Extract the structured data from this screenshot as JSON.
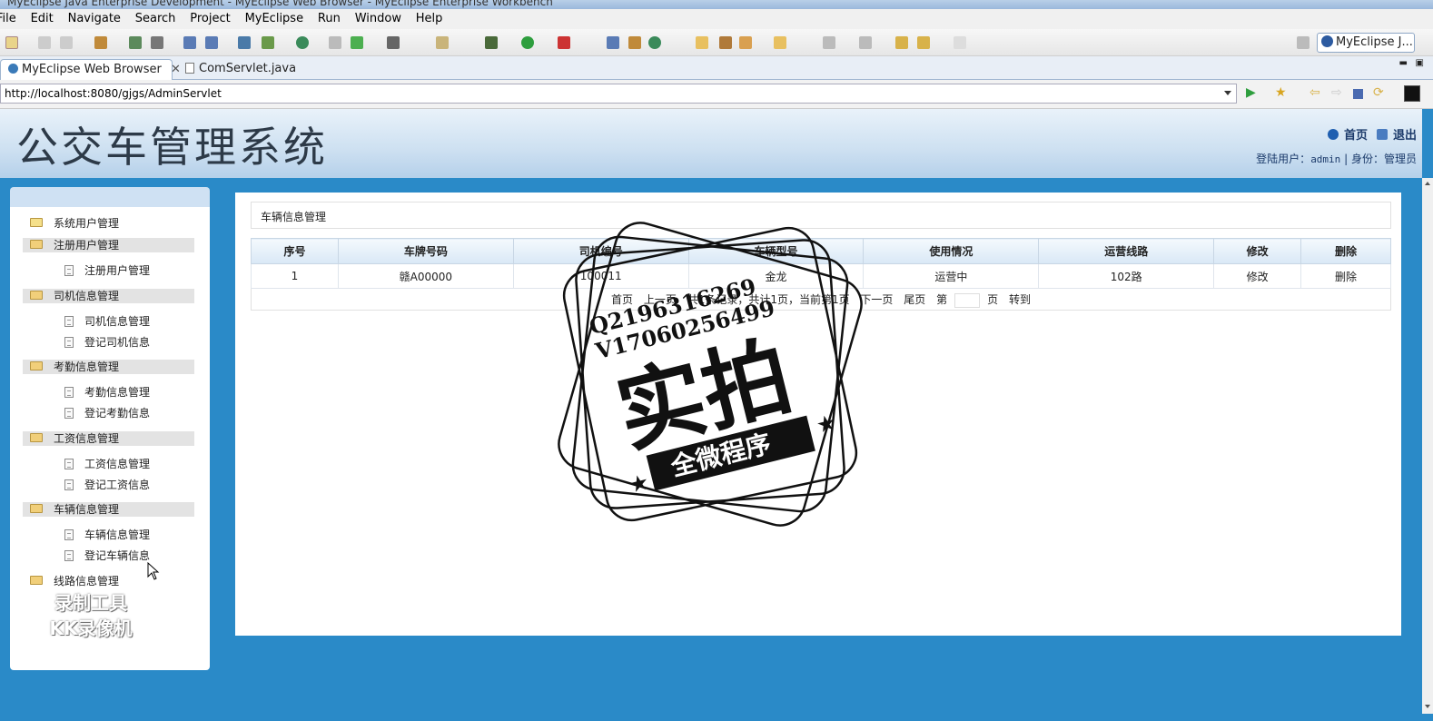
{
  "window": {
    "title": "MyEclipse Java Enterprise Development - MyEclipse Web Browser - MyEclipse Enterprise Workbench"
  },
  "menu": [
    "File",
    "Edit",
    "Navigate",
    "Search",
    "Project",
    "MyEclipse",
    "Run",
    "Window",
    "Help"
  ],
  "perspective": "MyEclipse J...",
  "tabs": [
    {
      "label": "MyEclipse Web Browser",
      "active": true
    },
    {
      "label": "ComServlet.java",
      "active": false
    }
  ],
  "address": {
    "url": "http://localhost:8080/gjgs/AdminServlet"
  },
  "header": {
    "title": "公交车管理系统",
    "home_link": "首页",
    "logout_link": "退出",
    "user_label": "登陆用户：",
    "user_name": "admin",
    "role_label": "| 身份：管理员"
  },
  "sidebar": {
    "groups": [
      {
        "label": "系统用户管理",
        "items": []
      },
      {
        "label": "注册用户管理",
        "items": [
          "注册用户管理"
        ]
      },
      {
        "label": "司机信息管理",
        "items": [
          "司机信息管理",
          "登记司机信息"
        ]
      },
      {
        "label": "考勤信息管理",
        "items": [
          "考勤信息管理",
          "登记考勤信息"
        ]
      },
      {
        "label": "工资信息管理",
        "items": [
          "工资信息管理",
          "登记工资信息"
        ]
      },
      {
        "label": "车辆信息管理",
        "items": [
          "车辆信息管理",
          "登记车辆信息"
        ]
      },
      {
        "label": "线路信息管理",
        "items": []
      }
    ]
  },
  "main": {
    "breadcrumb": "车辆信息管理",
    "table": {
      "headers": [
        "序号",
        "车牌号码",
        "司机编号",
        "车辆型号",
        "使用情况",
        "运营线路",
        "修改",
        "删除"
      ],
      "rows": [
        [
          "1",
          "赣A00000",
          "100011",
          "金龙",
          "运营中",
          "102路",
          "修改",
          "删除"
        ]
      ]
    },
    "pager": {
      "first": "首页",
      "prev": "上一页",
      "summary": "共1条记录，共计1页，当前第1页",
      "next": "下一页",
      "last": "尾页",
      "page_prefix": "第",
      "page_suffix": "页",
      "go": "转到"
    }
  },
  "overlay": {
    "stamp_line1": "Q2196316269",
    "stamp_line2": "V17060256499",
    "stamp_main": "实拍",
    "stamp_banner": "全微程序",
    "recorder_line1": "录制工具",
    "recorder_line2": "KK录像机"
  }
}
